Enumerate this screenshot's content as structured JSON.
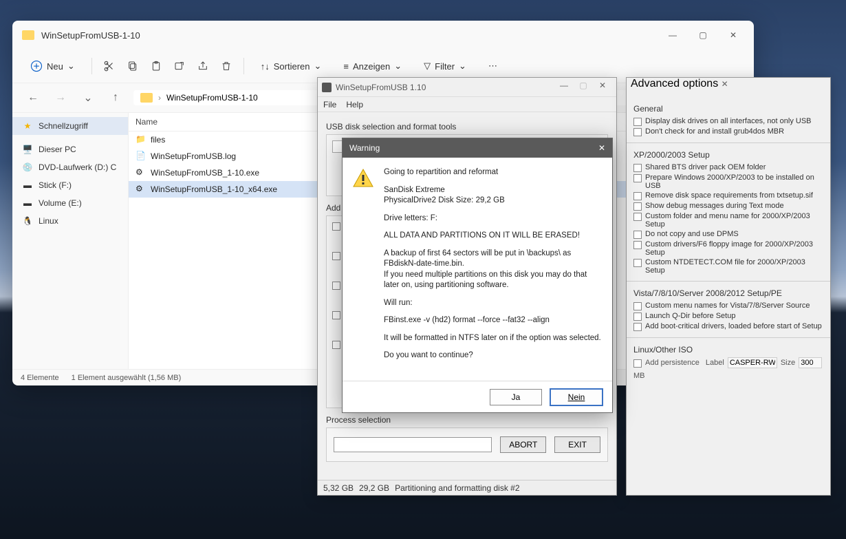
{
  "explorer": {
    "title": "WinSetupFromUSB-1-10",
    "new_label": "Neu",
    "sort_label": "Sortieren",
    "view_label": "Anzeigen",
    "filter_label": "Filter",
    "breadcrumb": "WinSetupFromUSB-1-10",
    "sidebar": {
      "quickaccess": "Schnellzugriff",
      "thispc": "Dieser PC",
      "dvd": "DVD-Laufwerk (D:) C",
      "stickf": "Stick (F:)",
      "volumee": "Volume (E:)",
      "linux": "Linux"
    },
    "col_name": "Name",
    "files": {
      "0": "files",
      "1": "WinSetupFromUSB.log",
      "2": "WinSetupFromUSB_1-10.exe",
      "3": "WinSetupFromUSB_1-10_x64.exe"
    },
    "status1": "4 Elemente",
    "status2": "1 Element ausgewählt (1,56 MB)"
  },
  "wsfu": {
    "title": "WinSetupFromUSB 1.10",
    "menu_file": "File",
    "menu_help": "Help",
    "usb_section": "USB disk selection and format tools",
    "add_section": "Add",
    "process_section": "Process selection",
    "abort": "ABORT",
    "exit": "EXIT",
    "status_size1": "5,32 GB",
    "status_size2": "29,2 GB",
    "status_msg": "Partitioning and formatting disk #2"
  },
  "adv": {
    "title": "Advanced options",
    "sec_general": "General",
    "g1": "Display disk drives on all interfaces, not only USB",
    "g2": "Don't check for and install grub4dos MBR",
    "sec_xp": "XP/2000/2003 Setup",
    "x1": "Shared BTS driver pack OEM folder",
    "x2": "Prepare Windows 2000/XP/2003 to be installed on USB",
    "x3": "Remove disk space requirements from txtsetup.sif",
    "x4": "Show debug messages during Text mode",
    "x5": "Custom folder and menu name for 2000/XP/2003 Setup",
    "x6": "Do not copy and use DPMS",
    "x7": "Custom drivers/F6 floppy image for 2000/XP/2003 Setup",
    "x8": "Custom NTDETECT.COM file for 2000/XP/2003 Setup",
    "sec_vista": "Vista/7/8/10/Server 2008/2012 Setup/PE",
    "v1": "Custom menu names for Vista/7/8/Server Source",
    "v2": "Launch Q-Dir before Setup",
    "v3": "Add boot-critical drivers, loaded before start of Setup",
    "sec_linux": "Linux/Other ISO",
    "l1": "Add persistence",
    "label_text": "Label",
    "label_val": "CASPER-RW",
    "size_text": "Size",
    "size_val": "300",
    "size_unit": "MB"
  },
  "warning": {
    "title": "Warning",
    "p1": "Going to repartition and reformat",
    "p2a": "SanDisk Extreme",
    "p2b": "PhysicalDrive2   Disk Size: 29,2 GB",
    "p3": "Drive letters:  F:",
    "p4": "ALL DATA AND PARTITIONS ON IT WILL BE ERASED!",
    "p5": "A backup of first 64 sectors will be put in \\backups\\ as FBdiskN-date-time.bin.",
    "p6": "If you need multiple partitions on this disk you may do that later on, using partitioning software.",
    "p7": "Will run:",
    "p8": "FBinst.exe -v (hd2) format --force  --fat32 --align",
    "p9": "It will be formatted in NTFS later on if the option was selected.",
    "p10": "Do you want to continue?",
    "yes": "Ja",
    "no": "Nein"
  }
}
